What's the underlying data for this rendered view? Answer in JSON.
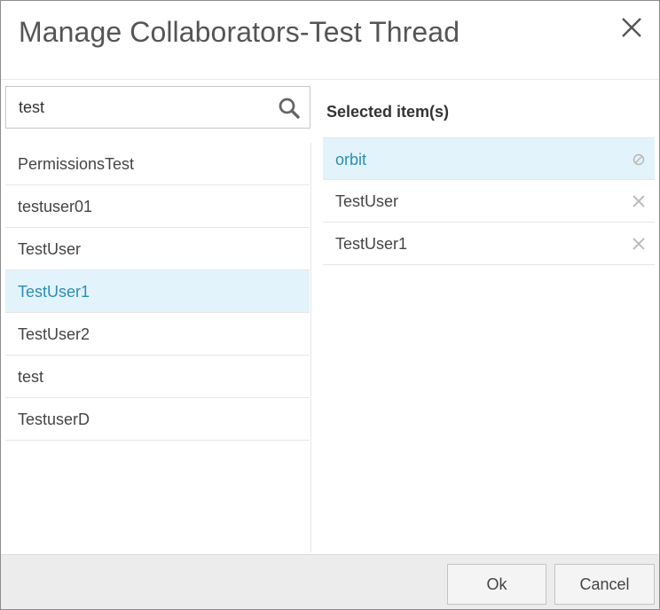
{
  "dialog": {
    "title": "Manage Collaborators-Test Thread",
    "close_icon": "close-icon"
  },
  "search": {
    "value": "test",
    "icon": "search-icon"
  },
  "results": [
    {
      "label": "PermissionsTest",
      "highlighted": false
    },
    {
      "label": "testuser01",
      "highlighted": false
    },
    {
      "label": "TestUser",
      "highlighted": false
    },
    {
      "label": "TestUser1",
      "highlighted": true
    },
    {
      "label": "TestUser2",
      "highlighted": false
    },
    {
      "label": "test",
      "highlighted": false
    },
    {
      "label": "TestuserD",
      "highlighted": false
    }
  ],
  "selected": {
    "heading": "Selected item(s)",
    "items": [
      {
        "label": "orbit",
        "locked": true,
        "icon": "disabled-icon"
      },
      {
        "label": "TestUser",
        "locked": false,
        "icon": "remove-icon"
      },
      {
        "label": "TestUser1",
        "locked": false,
        "icon": "remove-icon"
      }
    ]
  },
  "footer": {
    "ok_label": "Ok",
    "cancel_label": "Cancel"
  },
  "colors": {
    "highlight_bg": "#e3f3fb",
    "highlight_text": "#2b8db5",
    "footer_bg": "#ececec"
  }
}
